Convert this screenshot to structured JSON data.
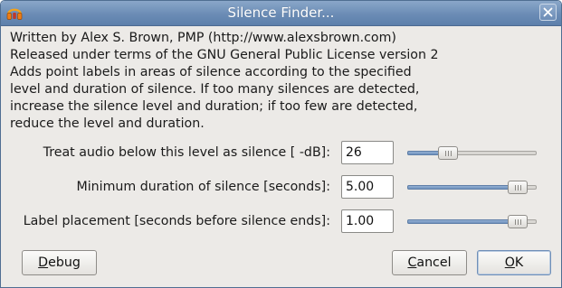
{
  "window": {
    "title": "Silence Finder...",
    "app_icon": "audacity-headphones-icon",
    "close_icon": "close-icon"
  },
  "description": {
    "lines": [
      "Written by Alex S. Brown, PMP (http://www.alexsbrown.com)",
      "Released under terms of the GNU General Public License version 2",
      "Adds point labels in areas of silence according to the specified",
      "level and duration of silence. If too many silences are detected,",
      "increase the silence level and duration; if too few are detected,",
      "reduce the level and duration."
    ]
  },
  "fields": {
    "level": {
      "label": "Treat audio below this level as silence [ -dB]:",
      "value": "26",
      "slider_fraction": 0.28
    },
    "duration": {
      "label": "Minimum duration of silence [seconds]:",
      "value": "5.00",
      "slider_fraction": 0.92
    },
    "placement": {
      "label": "Label placement [seconds before silence ends]:",
      "value": "1.00",
      "slider_fraction": 0.92
    }
  },
  "buttons": {
    "debug": {
      "mnemonic": "D",
      "rest": "ebug"
    },
    "cancel": {
      "mnemonic": "C",
      "rest": "ancel"
    },
    "ok": {
      "mnemonic": "O",
      "rest": "K"
    }
  },
  "colors": {
    "titlebar": "#6b8cb5",
    "dialog_bg": "#eceae7",
    "slider_fill": "#6f91bd"
  }
}
